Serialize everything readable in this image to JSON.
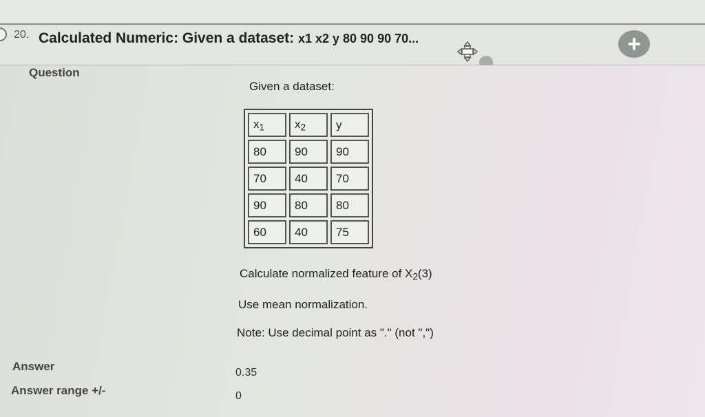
{
  "question": {
    "number": "20.",
    "title": "Calculated Numeric: Given a dataset:",
    "title_tail": "x1 x2 y 80 90 90 70...",
    "question_label": "Question",
    "intro": "Given a dataset:",
    "table": {
      "headers": [
        "x",
        "x",
        "y"
      ],
      "header_subscripts": [
        "1",
        "2",
        ""
      ],
      "rows": [
        [
          "80",
          "90",
          "90"
        ],
        [
          "70",
          "40",
          "70"
        ],
        [
          "90",
          "80",
          "80"
        ],
        [
          "60",
          "40",
          "75"
        ]
      ]
    },
    "instruction_prefix": "Calculate normalized feature of X",
    "instruction_subscript": "2",
    "instruction_suffix": "(3)",
    "method": "Use mean normalization.",
    "note": "Note: Use decimal point as \".\" (not \",\")"
  },
  "answer": {
    "label": "Answer",
    "value": "0.35",
    "range_label": "Answer range +/-",
    "range_value": "0"
  },
  "icons": {
    "move": "move-icon",
    "add": "plus-circle-icon",
    "status": "status-dot-icon"
  }
}
